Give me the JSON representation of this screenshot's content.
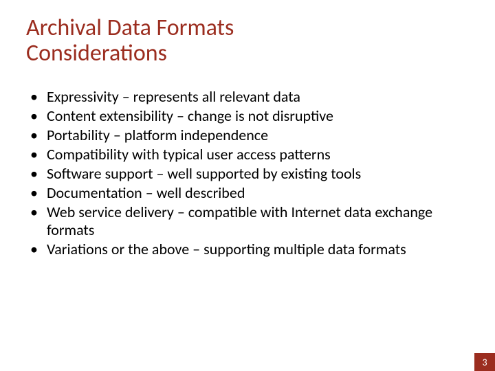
{
  "title_line1": "Archival Data Formats",
  "title_line2": "Considerations",
  "bullets": [
    "Expressivity – represents all relevant data",
    "Content extensibility – change is not disruptive",
    "Portability – platform independence",
    "Compatibility with typical user access patterns",
    "Software support – well supported by existing tools",
    "Documentation – well described",
    "Web service delivery – compatible with Internet data exchange formats",
    "Variations or the above – supporting multiple data formats"
  ],
  "page_number": "3",
  "colors": {
    "accent": "#9b2d1f",
    "text": "#000000",
    "page_number_text": "#ffffff"
  }
}
